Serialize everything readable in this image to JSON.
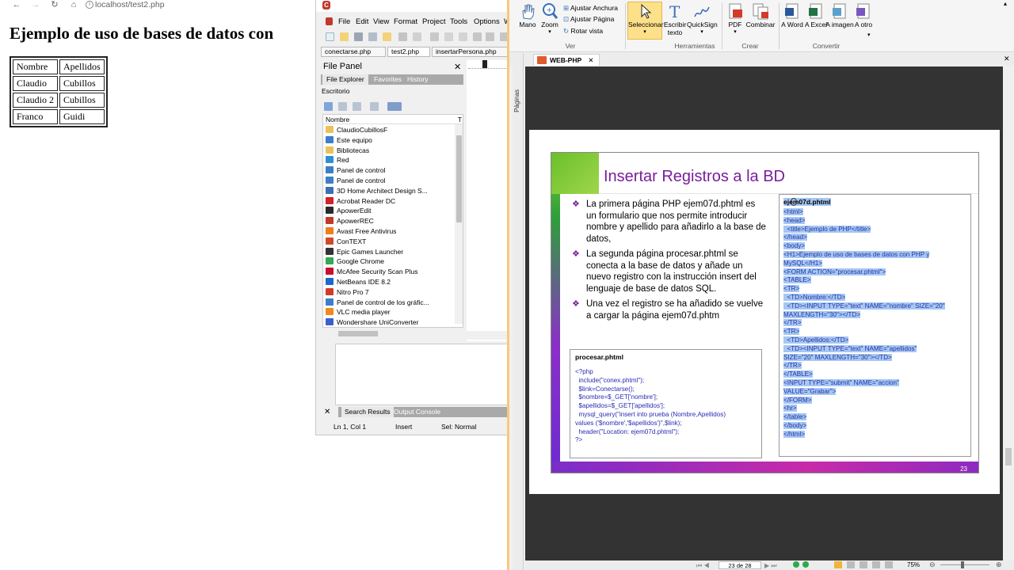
{
  "browser": {
    "url": "localhost/test2.php",
    "heading": "Ejemplo de uso de bases de datos con",
    "table": [
      [
        "Nombre",
        "Apellidos"
      ],
      [
        "Claudio",
        "Cubillos"
      ],
      [
        "Claudio 2",
        "Cubillos"
      ],
      [
        "Franco",
        "Guidi"
      ]
    ]
  },
  "editor": {
    "menu": [
      "File",
      "Edit",
      "View",
      "Format",
      "Project",
      "Tools",
      "Options",
      "W"
    ],
    "tabs": [
      "conectarse.php",
      "test2.php",
      "insertarPersona.php"
    ],
    "file_panel": {
      "title": "File Panel",
      "close": "✕",
      "tabs": [
        "File Explorer",
        "Favorites",
        "History"
      ],
      "location": "Escritorio",
      "column": "Nombre",
      "column_t": "T",
      "items": [
        {
          "label": "ClaudioCubillosF",
          "color": "#e8c35a"
        },
        {
          "label": "Este equipo",
          "color": "#3c7fc9"
        },
        {
          "label": "Bibliotecas",
          "color": "#e8c35a"
        },
        {
          "label": "Red",
          "color": "#2f8fd6"
        },
        {
          "label": "Panel de control",
          "color": "#3c7fc9"
        },
        {
          "label": "Panel de control",
          "color": "#3c7fc9"
        },
        {
          "label": "3D Home Architect Design S...",
          "color": "#3d6fb6"
        },
        {
          "label": "Acrobat Reader DC",
          "color": "#d1232a"
        },
        {
          "label": "ApowerEdit",
          "color": "#2a2a2a"
        },
        {
          "label": "ApowerREC",
          "color": "#c0392b"
        },
        {
          "label": "Avast Free Antivirus",
          "color": "#f07d1a"
        },
        {
          "label": "ConTEXT",
          "color": "#d04a2a"
        },
        {
          "label": "Epic Games Launcher",
          "color": "#333333"
        },
        {
          "label": "Google Chrome",
          "color": "#34a853"
        },
        {
          "label": "McAfee Security Scan Plus",
          "color": "#c8102e"
        },
        {
          "label": "NetBeans IDE 8.2",
          "color": "#1b6ac9"
        },
        {
          "label": "Nitro Pro 7",
          "color": "#d23a2a"
        },
        {
          "label": "Panel de control de los gráfic...",
          "color": "#3c7fc9"
        },
        {
          "label": "VLC media player",
          "color": "#f08a1c"
        },
        {
          "label": "Wondershare UniConverter",
          "color": "#3a5fcd"
        }
      ]
    },
    "output": {
      "close": "✕",
      "tabs": [
        "Search Results",
        "Output Console"
      ]
    },
    "status": {
      "position": "Ln 1, Col 1",
      "mode": "Insert",
      "selection": "Sel: Normal"
    }
  },
  "pdf": {
    "ribbon": {
      "mano": "Mano",
      "zoom": "Zoom",
      "ajustar_anchura": "Ajustar Anchura",
      "ajustar_pagina": "Ajustar Página",
      "rotar_vista": "Rotar vista",
      "seleccionar": "Seleccionar",
      "escribir_texto": "Escribir texto",
      "quicksign": "QuickSign",
      "pdf": "PDF",
      "combinar": "Combinar",
      "a_word": "A Word",
      "a_excel": "A Excel",
      "a_imagen": "A imagen",
      "a_otro": "A otro",
      "group_ver": "Ver",
      "group_herramientas": "Herramientas",
      "group_crear": "Crear",
      "group_convertir": "Convertir"
    },
    "tab": "WEB-PHP",
    "side_label": "Páginas",
    "page_indicator": "23 de 28",
    "zoom": "75%",
    "slide": {
      "title": "Insertar Registros a la BD",
      "bullets": [
        "La primera página PHP ejem07d.phtml es un formulario que nos permite introducir nombre y apellido para añadirlo a la base de datos,",
        "La segunda página procesar.phtml se conecta a la base de datos y añade un nuevo registro con la instrucción insert del lenguaje de base de datos SQL.",
        "Una vez el registro se ha añadido se vuelve a cargar la página ejem07d.phtm"
      ],
      "code1_title": "procesar.phtml",
      "code1": [
        "<?php",
        "  include(\"conex.phtml\");",
        "  $link=Conectarse();",
        "  $nombre=$_GET['nombre'];",
        "  $apellidos=$_GET['apellidos'];",
        "  mysql_query(\"insert into prueba (Nombre,Apellidos)",
        "values ('$nombre','$apellidos')\",$link);",
        "",
        "  header(\"Location: ejem07d.phtml\");",
        "?>"
      ],
      "code2_title": "ejem07d.phtml",
      "code2": [
        "",
        "<html>",
        "<head>",
        "  <title>Ejemplo de PHP</title>",
        "</head>",
        "<body>",
        "<H1>Ejemplo de uso de bases de datos con PHP y",
        "MySQL</H1>",
        "<FORM ACTION=\"procesar.phtml\">",
        "<TABLE>",
        "<TR>",
        "  <TD>Nombre:</TD>",
        "  <TD><INPUT TYPE=\"text\" NAME=\"nombre\" SIZE=\"20\"",
        "MAXLENGTH=\"30\"></TD>",
        "</TR>",
        "<TR>",
        "  <TD>Apellidos:</TD>",
        "  <TD><INPUT TYPE=\"text\" NAME=\"apellidos\"",
        "SIZE=\"20\" MAXLENGTH=\"30\"></TD>",
        "</TR>",
        "</TABLE>",
        "<INPUT TYPE=\"submit\" NAME=\"accion\"",
        "VALUE=\"Grabar\">",
        "</FORM>",
        "<hr>",
        "",
        "</table>",
        "</body>",
        "</html>"
      ],
      "page_number": "23"
    }
  }
}
